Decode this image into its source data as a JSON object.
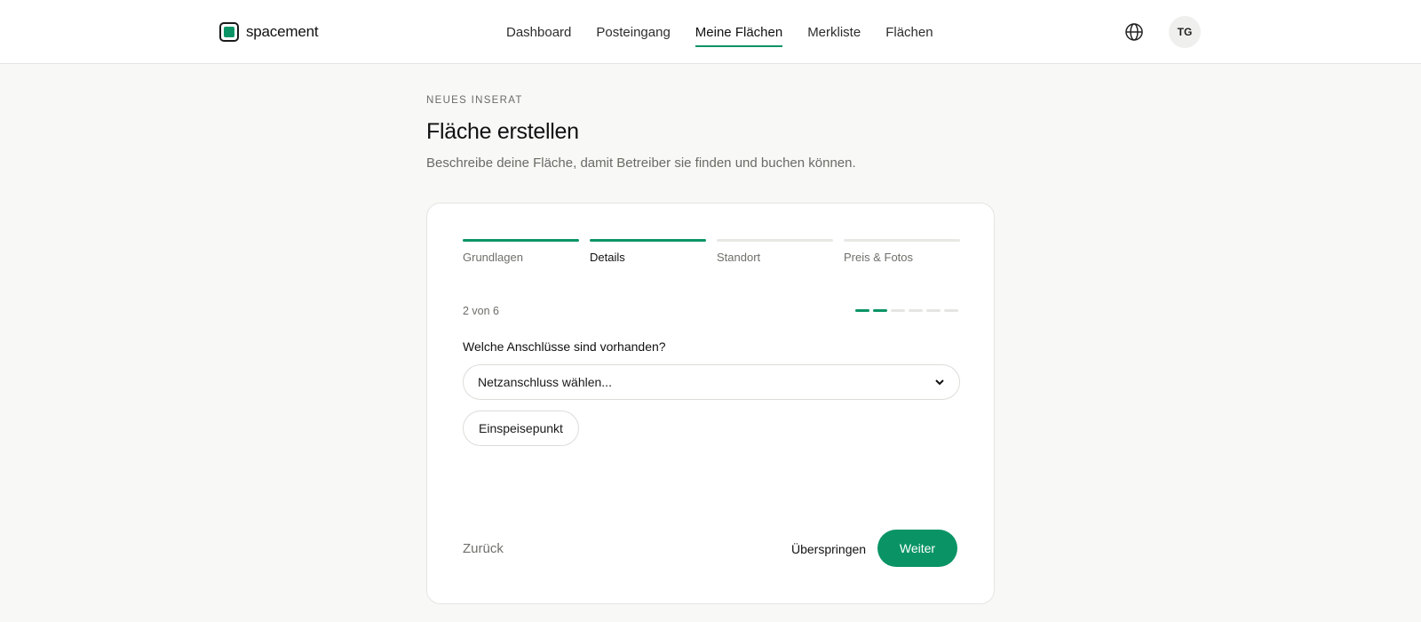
{
  "header": {
    "brand": "spacement",
    "nav": [
      {
        "label": "Dashboard",
        "active": false
      },
      {
        "label": "Posteingang",
        "active": false
      },
      {
        "label": "Meine Flächen",
        "active": true
      },
      {
        "label": "Merkliste",
        "active": false
      },
      {
        "label": "Flächen",
        "active": false
      }
    ],
    "language_icon": "globe-icon",
    "avatar_initials": "TG"
  },
  "page": {
    "eyebrow": "NEUES INSERAT",
    "title": "Fläche erstellen",
    "subtitle": "Beschreibe deine Fläche, damit Betreiber sie finden und buchen können."
  },
  "wizard": {
    "steps": [
      {
        "label": "Grundlagen",
        "state": "done"
      },
      {
        "label": "Details",
        "state": "current"
      },
      {
        "label": "Standort",
        "state": "todo"
      },
      {
        "label": "Preis & Fotos",
        "state": "todo"
      }
    ],
    "progress_text": "2 von 6",
    "progress": {
      "current": 2,
      "total": 6
    },
    "question": "Welche Anschlüsse sind vorhanden?",
    "select": {
      "value": "Netzanschluss wählen..."
    },
    "chip": "Einspeisepunkt",
    "back_label": "Zurück",
    "skip_label": "Überspringen",
    "next_label": "Weiter"
  },
  "colors": {
    "accent": "#0a9466",
    "background": "#f8f8f6",
    "muted_text": "#6f6f6a"
  }
}
